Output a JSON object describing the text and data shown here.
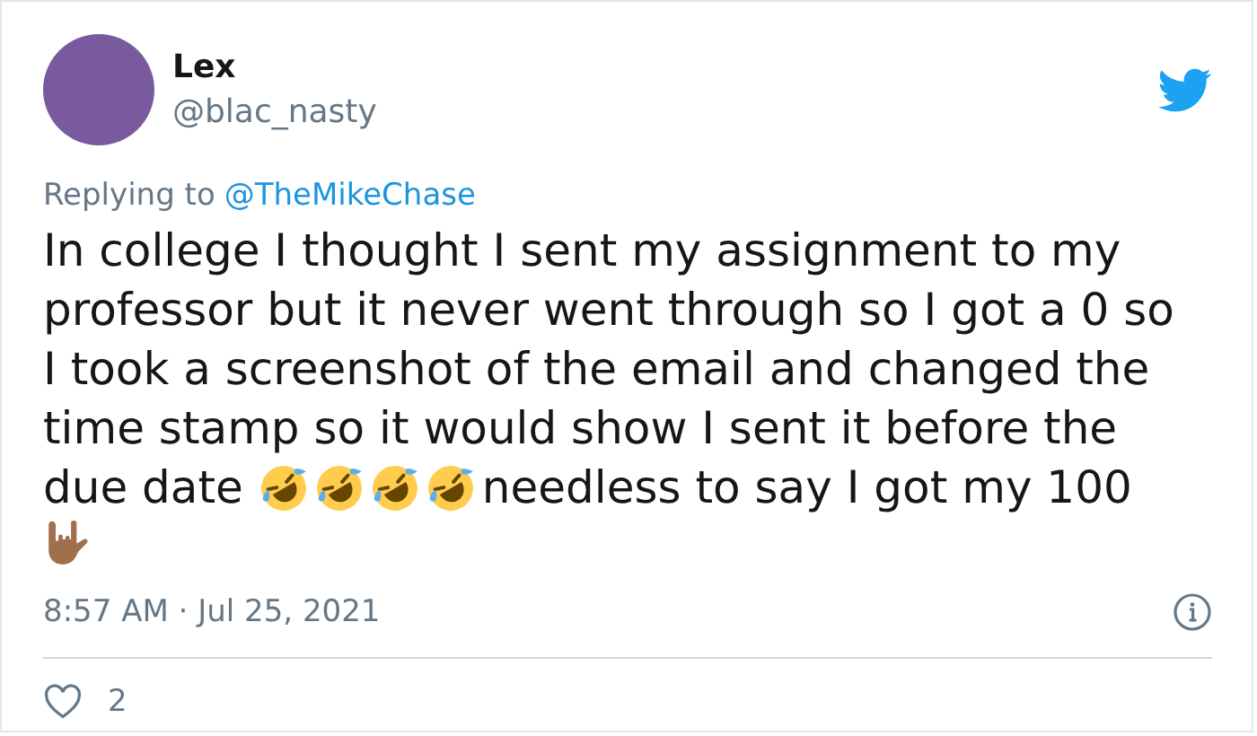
{
  "author": {
    "name": "Lex",
    "handle": "@blac_nasty"
  },
  "reply_to": {
    "prefix": "Replying to",
    "handle": "@TheMikeChase"
  },
  "body": [
    {
      "kind": "paragraph",
      "text": "In college I thought I sent my assignment to my professor but it never went through so I got a 0 so I took a screenshot of the email and changed the time stamp so it would show I sent it before the"
    },
    {
      "kind": "text",
      "text": "due date"
    },
    {
      "kind": "laugh-emoji"
    },
    {
      "kind": "laugh-emoji"
    },
    {
      "kind": "laugh-emoji"
    },
    {
      "kind": "laugh-emoji"
    },
    {
      "kind": "text",
      "text": "needless to say I got my 100"
    },
    {
      "kind": "hand-emoji"
    }
  ],
  "timestamp": "8:57 AM · Jul 25, 2021",
  "likes": "2"
}
